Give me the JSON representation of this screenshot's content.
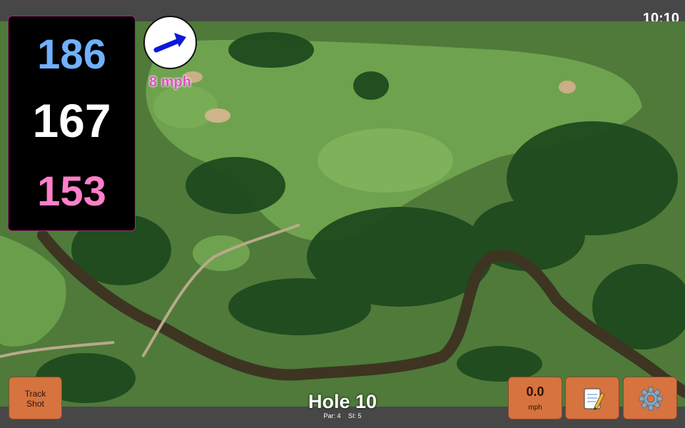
{
  "status_bar": {
    "time": "10:10"
  },
  "distances": {
    "back": "186",
    "middle": "167",
    "front": "153"
  },
  "wind": {
    "speed_text": "8 mph",
    "arrow_color": "#0a1ad8"
  },
  "hole": {
    "title": "Hole 10",
    "par_label": "Par: 4",
    "si_label": "SI: 5"
  },
  "buttons": {
    "track_shot_line1": "Track",
    "track_shot_line2": "Shot",
    "speed_value": "0.0",
    "speed_unit": "mph",
    "notes_icon": "notepad-icon",
    "settings_icon": "gear-icon"
  },
  "colors": {
    "back_distance": "#6fb1ff",
    "middle_distance": "#ffffff",
    "front_distance": "#ff7fc9",
    "button_bg": "#d6733f",
    "wind_text": "#e44fc4"
  }
}
